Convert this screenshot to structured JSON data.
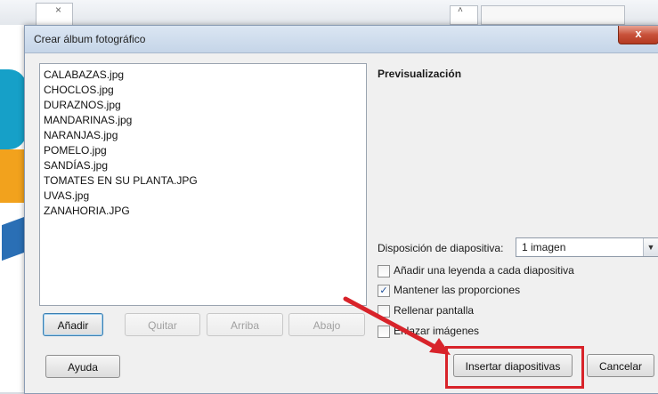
{
  "background": {
    "close_x": "×",
    "caret": "˄"
  },
  "dialog": {
    "title": "Crear álbum fotográfico",
    "close_icon": "x"
  },
  "files": [
    "CALABAZAS.jpg",
    "CHOCLOS.jpg",
    "DURAZNOS.jpg",
    "MANDARINAS.jpg",
    "NARANJAS.jpg",
    "POMELO.jpg",
    "SANDÍAS.jpg",
    "TOMATES EN SU PLANTA.JPG",
    "UVAS.jpg",
    "ZANAHORIA.JPG"
  ],
  "list_buttons": {
    "add": "Añadir",
    "remove": "Quitar",
    "up": "Arriba",
    "down": "Abajo"
  },
  "preview_label": "Previsualización",
  "layout": {
    "label": "Disposición de diapositiva:",
    "value": "1 imagen",
    "arrow": "▼"
  },
  "options": [
    {
      "label": "Añadir una leyenda a cada diapositiva",
      "checked": false
    },
    {
      "label": "Mantener las proporciones",
      "checked": true
    },
    {
      "label": "Rellenar pantalla",
      "checked": false
    },
    {
      "label": "Enlazar imágenes",
      "checked": false
    }
  ],
  "footer": {
    "help": "Ayuda",
    "insert": "Insertar diapositivas",
    "cancel": "Cancelar"
  },
  "colors": {
    "annotation": "#d8232a"
  }
}
